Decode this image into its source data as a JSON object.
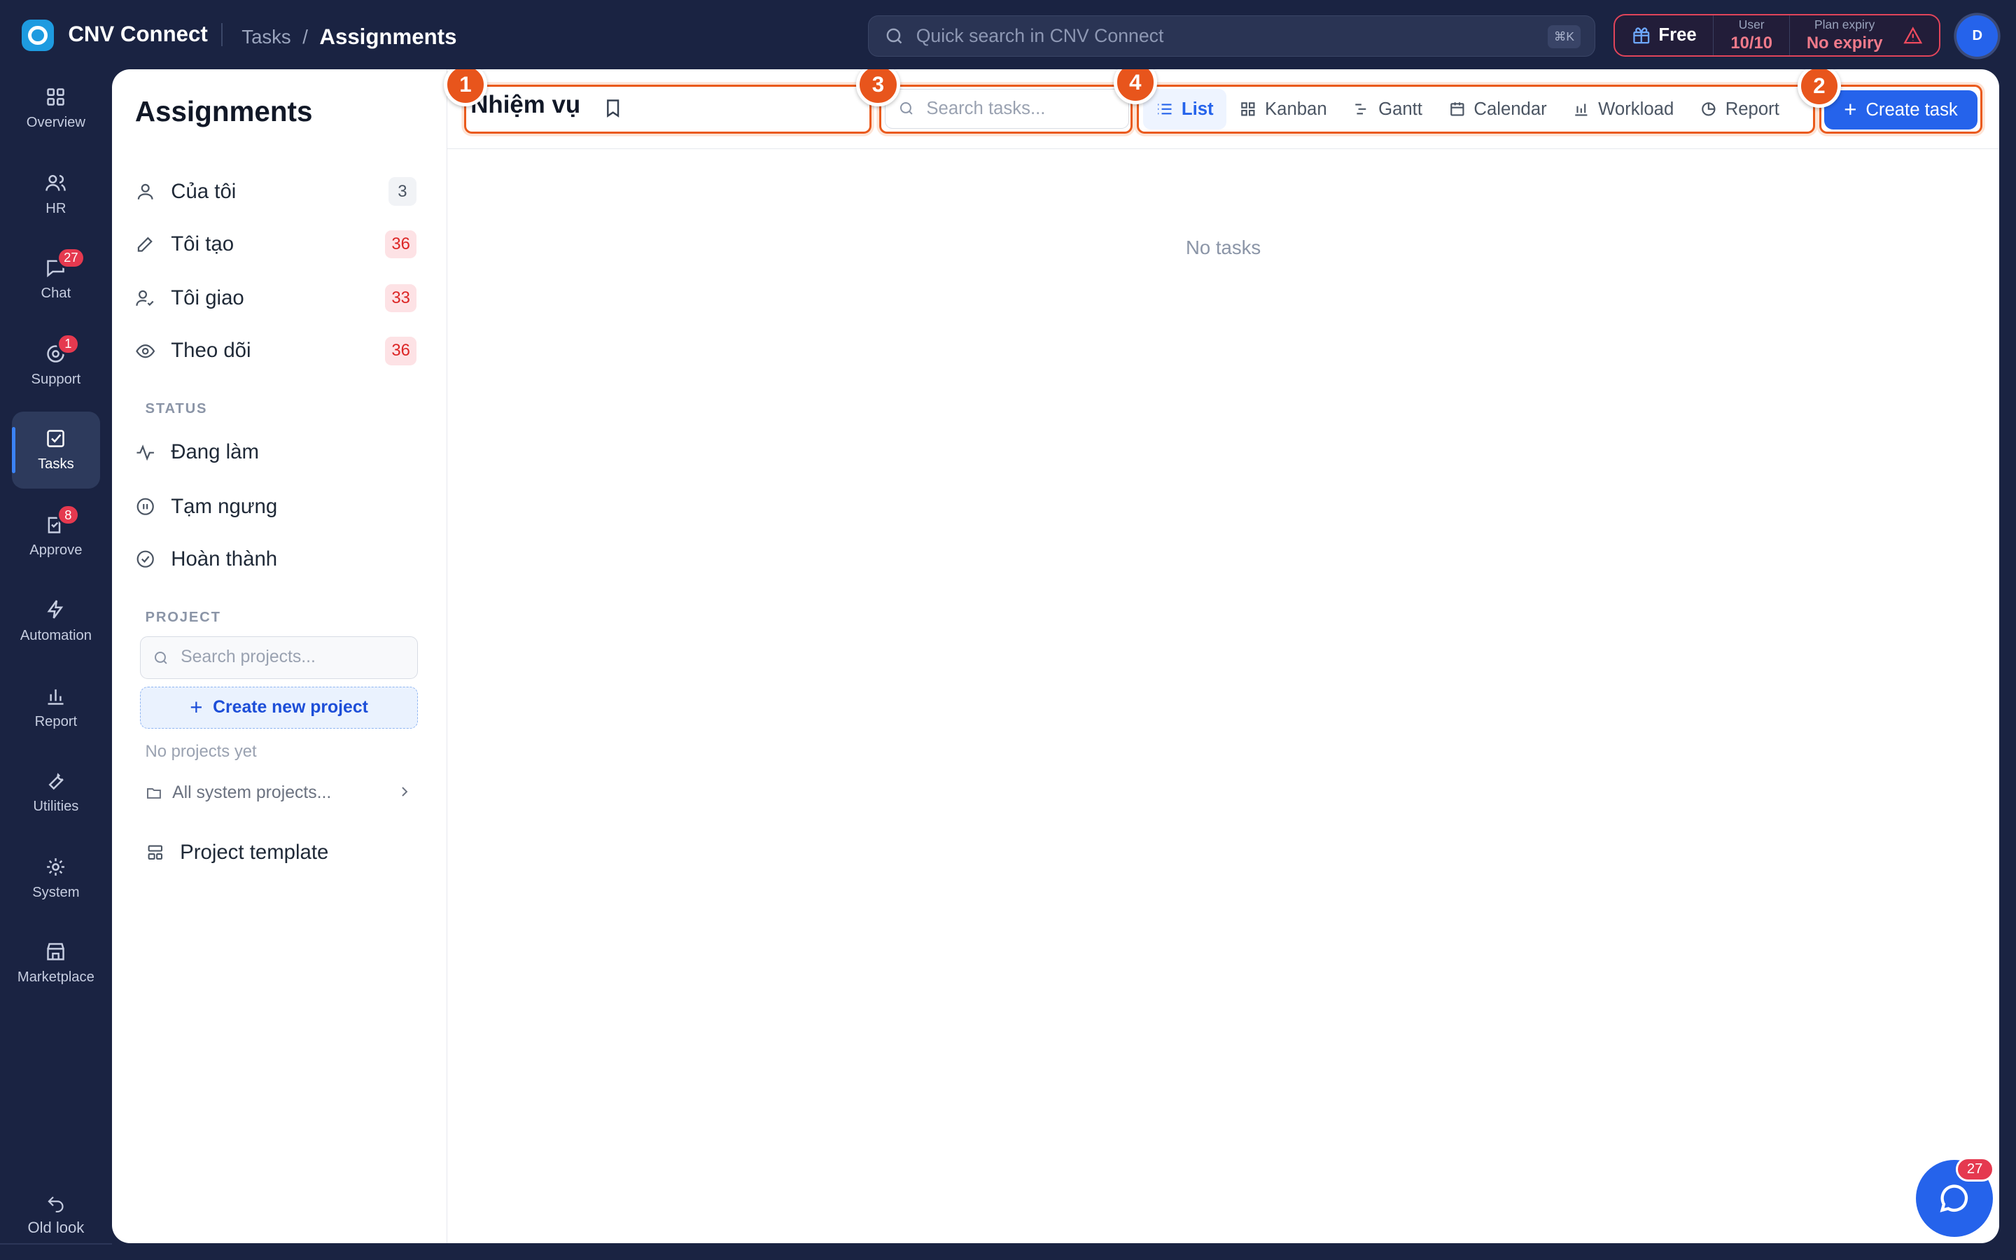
{
  "app": {
    "name": "CNV Connect"
  },
  "breadcrumb": {
    "parent": "Tasks",
    "sep": "/",
    "current": "Assignments"
  },
  "quick_search": {
    "placeholder": "Quick search in CNV Connect",
    "shortcut": "⌘K"
  },
  "plan": {
    "name": "Free",
    "user_label": "User",
    "user_value": "10/10",
    "expiry_label": "Plan expiry",
    "expiry_value": "No expiry"
  },
  "avatar": {
    "initial": "D"
  },
  "rail": {
    "items": [
      {
        "label": "Overview",
        "icon": "grid-icon"
      },
      {
        "label": "HR",
        "icon": "users-icon"
      },
      {
        "label": "Chat",
        "icon": "chat-icon",
        "badge": "27"
      },
      {
        "label": "Support",
        "icon": "support-icon",
        "badge": "1"
      },
      {
        "label": "Tasks",
        "icon": "checkbox-icon",
        "active": true
      },
      {
        "label": "Approve",
        "icon": "approve-icon",
        "badge": "8"
      },
      {
        "label": "Automation",
        "icon": "bolt-icon"
      },
      {
        "label": "Report",
        "icon": "bar-chart-icon"
      },
      {
        "label": "Utilities",
        "icon": "wrench-icon"
      },
      {
        "label": "System",
        "icon": "gear-icon"
      },
      {
        "label": "Marketplace",
        "icon": "store-icon"
      }
    ],
    "old_look": "Old look"
  },
  "sidebar": {
    "title": "Assignments",
    "items": [
      {
        "label": "Của tôi",
        "count": "3"
      },
      {
        "label": "Tôi tạo",
        "count": "36"
      },
      {
        "label": "Tôi giao",
        "count": "33"
      },
      {
        "label": "Theo dõi",
        "count": "36"
      }
    ],
    "status_heading": "STATUS",
    "status_items": [
      {
        "label": "Đang làm"
      },
      {
        "label": "Tạm ngưng"
      },
      {
        "label": "Hoàn thành"
      }
    ],
    "project_heading": "PROJECT",
    "project_search_placeholder": "Search projects...",
    "create_project": "Create new project",
    "no_projects": "No projects yet",
    "all_projects": "All system projects...",
    "project_template": "Project template"
  },
  "toolbar": {
    "title": "Nhiệm vụ",
    "search_placeholder": "Search tasks...",
    "views": [
      "List",
      "Kanban",
      "Gantt",
      "Calendar",
      "Workload",
      "Report"
    ],
    "create_label": "Create task"
  },
  "markers": [
    "1",
    "3",
    "4",
    "2"
  ],
  "main": {
    "empty_text": "No tasks"
  },
  "chat_fab": {
    "badge": "27"
  },
  "colors": {
    "accent": "#2563eb",
    "highlight": "#ea5a1c",
    "background": "#1a2342",
    "badge": "#e5394f"
  }
}
